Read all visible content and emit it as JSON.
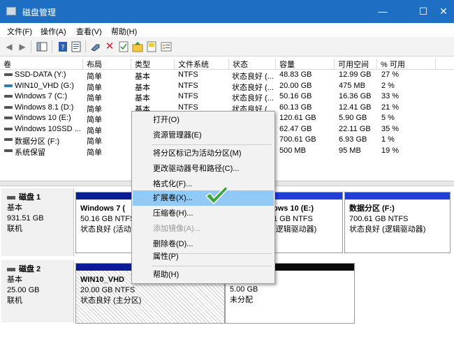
{
  "window": {
    "title": "磁盘管理",
    "controls": {
      "minimize": "—",
      "maximize": "☐",
      "close": "✕"
    }
  },
  "menubar": {
    "items": [
      "文件(F)",
      "操作(A)",
      "查看(V)",
      "帮助(H)"
    ]
  },
  "toolbar": {
    "icons": [
      "back-arrow",
      "forward-arrow",
      "console-tree",
      "help-book",
      "help-topics",
      "connect",
      "delete-x",
      "properties-check",
      "refresh-folder",
      "new-volume",
      "properties-list"
    ]
  },
  "volume_table": {
    "headers": [
      "卷",
      "布局",
      "类型",
      "文件系统",
      "状态",
      "容量",
      "可用空间",
      "% 可用"
    ],
    "rows": [
      {
        "volume": "SSD-DATA (Y:)",
        "layout": "简单",
        "type": "基本",
        "fs": "NTFS",
        "status": "状态良好 (...",
        "capacity": "48.83 GB",
        "free": "12.99 GB",
        "pct": "27 %"
      },
      {
        "volume": "WIN10_VHD (G:)",
        "layout": "简单",
        "type": "基本",
        "fs": "NTFS",
        "status": "状态良好 (...",
        "capacity": "20.00 GB",
        "free": "475 MB",
        "pct": "2 %"
      },
      {
        "volume": "Windows 7 (C:)",
        "layout": "简单",
        "type": "基本",
        "fs": "NTFS",
        "status": "状态良好 (...",
        "capacity": "50.16 GB",
        "free": "16.36 GB",
        "pct": "33 %"
      },
      {
        "volume": "Windows 8.1 (D:)",
        "layout": "简单",
        "type": "基本",
        "fs": "NTFS",
        "status": "状态良好 (...",
        "capacity": "60.13 GB",
        "free": "12.41 GB",
        "pct": "21 %"
      },
      {
        "volume": "Windows 10 (E:)",
        "layout": "简单",
        "type": "",
        "fs": "",
        "status": "",
        "capacity": "120.61 GB",
        "free": "5.90 GB",
        "pct": "5 %"
      },
      {
        "volume": "Windows 10SSD ...",
        "layout": "简单",
        "type": "",
        "fs": "",
        "status": "",
        "capacity": "62.47 GB",
        "free": "22.11 GB",
        "pct": "35 %"
      },
      {
        "volume": "数据分区 (F:)",
        "layout": "简单",
        "type": "",
        "fs": "",
        "status": "",
        "capacity": "700.61 GB",
        "free": "6.93 GB",
        "pct": "1 %"
      },
      {
        "volume": "系统保留",
        "layout": "简单",
        "type": "",
        "fs": "",
        "status": "",
        "capacity": "500 MB",
        "free": "95 MB",
        "pct": "19 %"
      }
    ]
  },
  "disks": [
    {
      "name": "磁盘 1",
      "type": "基本",
      "size": "931.51 GB",
      "state": "联机",
      "partitions": [
        {
          "label": "Windows 7 (",
          "size": "50.16 GB NTFS",
          "status": "状态良好 (活动"
        },
        {
          "label": "ows 10 (E:)",
          "size": "1 GB NTFS",
          "status": "(逻辑驱动器)"
        },
        {
          "label": "数据分区 (F:)",
          "size": "700.61 GB NTFS",
          "status": "状态良好 (逻辑驱动器)"
        }
      ]
    },
    {
      "name": "磁盘 2",
      "type": "基本",
      "size": "25.00 GB",
      "state": "联机",
      "partitions": [
        {
          "label": "WIN10_VHD",
          "size": "20.00 GB NTFS",
          "status": "状态良好 (主分区)"
        },
        {
          "label": "",
          "size": "5.00 GB",
          "status": "未分配"
        }
      ]
    }
  ],
  "context_menu": {
    "items": [
      {
        "label": "打开(O)",
        "enabled": true
      },
      {
        "label": "资源管理器(E)",
        "enabled": true
      },
      {
        "label": "将分区标记为活动分区(M)",
        "enabled": true
      },
      {
        "label": "更改驱动器号和路径(C)...",
        "enabled": true
      },
      {
        "label": "格式化(F)...",
        "enabled": true
      },
      {
        "label": "扩展卷(X)...",
        "enabled": true,
        "highlighted": true
      },
      {
        "label": "压缩卷(H)...",
        "enabled": true
      },
      {
        "label": "添加镜像(A)...",
        "enabled": false
      },
      {
        "label": "删除卷(D)...",
        "enabled": true
      },
      {
        "label": "属性(P)",
        "enabled": true
      },
      {
        "label": "帮助(H)",
        "enabled": true
      }
    ]
  },
  "colors": {
    "titlebar": "#1e6fc4",
    "primary_partition": "#0a1c96",
    "logical_partition": "#1f3fd6",
    "unallocated": "#0a0a0a",
    "highlight": "#91c9f7",
    "checkmark": "#3aa63a"
  }
}
